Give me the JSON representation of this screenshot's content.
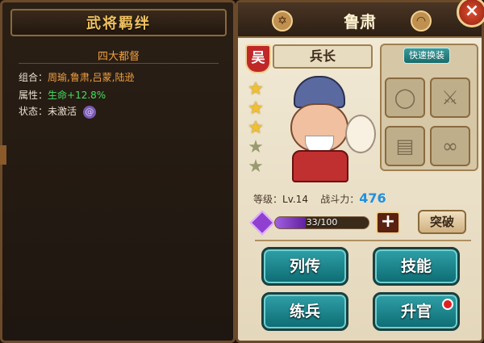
{
  "left": {
    "title": "武将羁绊",
    "subtitle": "四大都督",
    "combo_label": "组合：",
    "combo_value": "周瑜,鲁肃,吕蒙,陆逊",
    "attr_label": "属性：",
    "attr_value": "生命+12.8%",
    "status_label": "状态：",
    "status_value": "未激活"
  },
  "right": {
    "hero_name": "鲁肃",
    "faction": "吴",
    "rank": "兵长",
    "stars_on": 3,
    "stars_total": 5,
    "quick_equip": "快速换装",
    "level_label": "等级：",
    "level_value": "Lv.14",
    "power_label": "战斗力：",
    "power_value": "476",
    "exp_text": "33/100",
    "exp_fraction": 0.33,
    "plus_label": "+",
    "breakthrough": "突破",
    "buttons": {
      "biography": "列传",
      "skills": "技能",
      "train": "练兵",
      "promote": "升官"
    },
    "close": "×",
    "colors": {
      "accent_teal": "#1a7a80",
      "faction_red": "#c02828",
      "power_blue": "#2090e0"
    }
  }
}
